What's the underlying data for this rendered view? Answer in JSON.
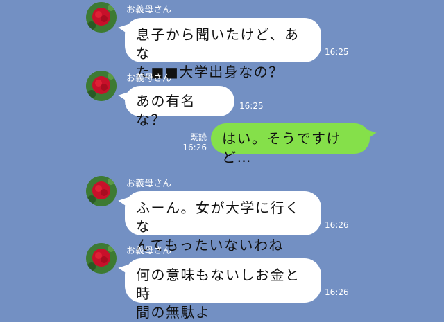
{
  "colors": {
    "background": "#7390c3",
    "incoming_bubble": "#ffffff",
    "outgoing_bubble": "#85e04a",
    "meta_text": "#ffffff"
  },
  "messages": [
    {
      "type": "incoming",
      "sender": "お義母さん",
      "lines": [
        "息子から聞いたけど、あな",
        "た■■大学出身なの？"
      ],
      "time": "16:25"
    },
    {
      "type": "incoming",
      "sender": "お義母さん",
      "lines": [
        "あの有名な？"
      ],
      "time": "16:25"
    },
    {
      "type": "outgoing",
      "read": "既読",
      "lines": [
        "はい。そうですけど…"
      ],
      "time": "16:26"
    },
    {
      "type": "incoming",
      "sender": "お義母さん",
      "lines": [
        "ふーん。女が大学に行くな",
        "んてもったいないわね"
      ],
      "time": "16:26"
    },
    {
      "type": "incoming",
      "sender": "お義母さん",
      "lines": [
        "何の意味もないしお金と時",
        "間の無駄よ"
      ],
      "time": "16:26"
    }
  ]
}
